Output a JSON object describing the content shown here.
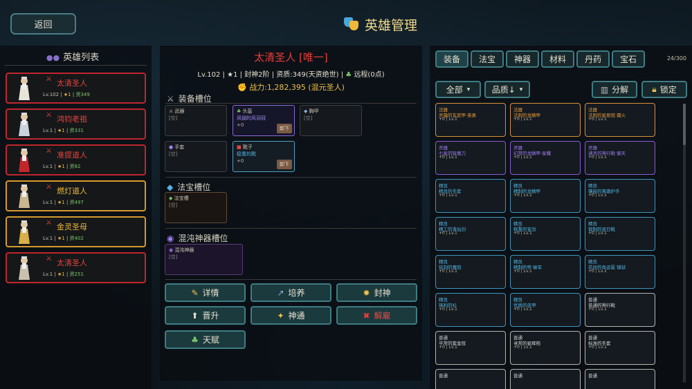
{
  "header": {
    "back_label": "返回",
    "title": "英雄管理"
  },
  "hero_list": {
    "title": "英雄列表",
    "heroes": [
      {
        "name": "太清圣人",
        "level": "Lv.102",
        "star": "★1",
        "aptitude": "资349",
        "rank": "red"
      },
      {
        "name": "鸿钧老祖",
        "level": "Lv.1",
        "star": "★1",
        "aptitude": "资331",
        "rank": "red"
      },
      {
        "name": "准提道人",
        "level": "Lv.1",
        "star": "★1",
        "aptitude": "资82",
        "rank": "red"
      },
      {
        "name": "燃灯道人",
        "level": "Lv.1",
        "star": "★1",
        "aptitude": "资497",
        "rank": "gold"
      },
      {
        "name": "金灵圣母",
        "level": "Lv.1",
        "star": "★1",
        "aptitude": "资402",
        "rank": "gold"
      },
      {
        "name": "太清圣人",
        "level": "Lv.1",
        "star": "★1",
        "aptitude": "资251",
        "rank": "red"
      }
    ]
  },
  "hero_detail": {
    "name": "太清圣人 [唯一]",
    "level": "Lv.102",
    "star": "★1",
    "feng_shen": "封神2阶",
    "aptitude": "资质:349(天资绝世)",
    "range": "远程(0点)",
    "power": "战力:1,282,395 (混元圣人)"
  },
  "equip_section": {
    "title": "装备槽位",
    "slots": [
      {
        "name": "武器",
        "value": "[空]",
        "value2": "",
        "equipped": false
      },
      {
        "name": "头盔",
        "value": "凤翅的凤羽冠",
        "value2": "+0",
        "equipped": true
      },
      {
        "name": "胸甲",
        "value": "[空]",
        "value2": "",
        "equipped": false
      },
      {
        "name": "手套",
        "value": "[空]",
        "value2": "",
        "equipped": false
      },
      {
        "name": "靴子",
        "value": "稳重的靴",
        "value2": "+0",
        "equipped": true
      }
    ],
    "unload_label": "卸下"
  },
  "treasure_section": {
    "title": "法宝槽位",
    "slot_name": "法宝槽",
    "slot_value": "[空]"
  },
  "chaos_section": {
    "title": "混沌神器槽位",
    "slot_name": "混沌神器",
    "slot_value": "[空]"
  },
  "actions": {
    "detail": "详情",
    "cultivate": "培养",
    "feng_shen": "封神",
    "promote": "晋升",
    "shen_tong": "神通",
    "dismiss": "解雇",
    "talent": "天赋"
  },
  "inventory": {
    "tabs": [
      "装备",
      "法宝",
      "神器",
      "材料",
      "丹药",
      "宝石"
    ],
    "count": "24/300",
    "filter_all": "全部",
    "filter_quality": "品质↓",
    "decompose": "分解",
    "lock": "锁定",
    "items": [
      {
        "q": "法器",
        "n": "灵蕴的玄武甲·奋勇",
        "l": "+0 | Lv.1",
        "t": "fa"
      },
      {
        "q": "法器",
        "n": "法则的龙鳞甲",
        "l": "+0 | Lv.1",
        "t": "fa"
      },
      {
        "q": "法器",
        "n": "法则的星辰冠·霜火",
        "l": "+0 | Lv.1",
        "t": "fa"
      },
      {
        "q": "灵器",
        "n": "七星的斩魔刀",
        "l": "+0 | Lv.1",
        "t": "ling"
      },
      {
        "q": "灵器",
        "n": "幻梦的龙鳞甲·星耀",
        "l": "+0 | Lv.1",
        "t": "ling"
      },
      {
        "q": "灵器",
        "n": "通灵的神行靴·御天",
        "l": "+0 | Lv.1",
        "t": "ling"
      },
      {
        "q": "精良",
        "n": "精良的手套",
        "l": "+0 | Lv.1",
        "t": "jing"
      },
      {
        "q": "精良",
        "n": "精制的龙鳞甲",
        "l": "+0 | Lv.1",
        "t": "jing"
      },
      {
        "q": "精良",
        "n": "镶嵌的寒霜护手",
        "l": "+0 | Lv.1",
        "t": "jing"
      },
      {
        "q": "精良",
        "n": "精工的诛仙剑",
        "l": "+0 | Lv.1",
        "t": "jing"
      },
      {
        "q": "精良",
        "n": "稳重的宝剑",
        "l": "+0 | Lv.1",
        "t": "jing"
      },
      {
        "q": "精良",
        "n": "锻制的逐日靴",
        "l": "+0 | Lv.1",
        "t": "jing"
      },
      {
        "q": "精良",
        "n": "铭刻的魔冠",
        "l": "+0 | Lv.1",
        "t": "jing"
      },
      {
        "q": "精良",
        "n": "精制的甲·破军",
        "l": "+0 | Lv.1",
        "t": "jing"
      },
      {
        "q": "精良",
        "n": "花纹的命运冕·镇狱",
        "l": "+0 | Lv.1",
        "t": "jing"
      },
      {
        "q": "精良",
        "n": "锋利的衫",
        "l": "+0 | Lv.1",
        "t": "jing"
      },
      {
        "q": "精良",
        "n": "优质的皮甲",
        "l": "+0 | Lv.1",
        "t": "jing"
      },
      {
        "q": "普通",
        "n": "普通的神行靴",
        "l": "+0 | Lv.1",
        "t": "pu"
      },
      {
        "q": "普通",
        "n": "平常的紫金冠",
        "l": "+0 | Lv.1",
        "t": "pu"
      },
      {
        "q": "普通",
        "n": "寻常的星辉袍",
        "l": "+0 | Lv.1",
        "t": "pu"
      },
      {
        "q": "普通",
        "n": "标准的手套",
        "l": "+0 | Lv.1",
        "t": "pu"
      },
      {
        "q": "普通",
        "n": "",
        "l": "",
        "t": "pu"
      },
      {
        "q": "普通",
        "n": "",
        "l": "",
        "t": "pu"
      },
      {
        "q": "普通",
        "n": "",
        "l": "",
        "t": "pu"
      }
    ]
  }
}
